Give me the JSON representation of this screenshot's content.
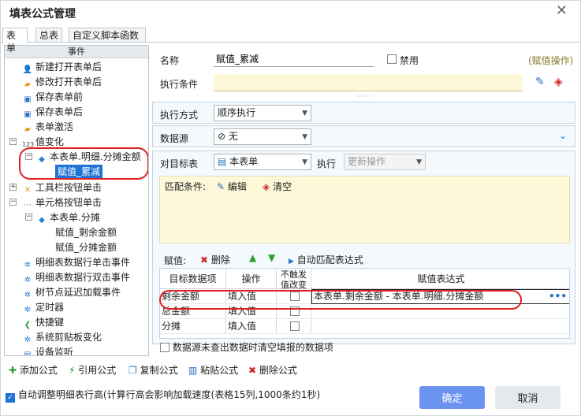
{
  "window": {
    "title": "填表公式管理"
  },
  "tabs": [
    "表单",
    "总表",
    "自定义脚本函数"
  ],
  "tree": {
    "header": "事件",
    "items": [
      "新建打开表单后",
      "修改打开表单后",
      "保存表单前",
      "保存表单后",
      "表单激活",
      "值变化",
      "本表单.明细.分摊金额",
      "赋值_累减",
      "工具栏按钮单击",
      "单元格按钮单击",
      "本表单.分摊",
      "赋值_剩余金额",
      "赋值_分摊金额",
      "明细表数据行单击事件",
      "明细表数据行双击事件",
      "树节点延迟加载事件",
      "定时器",
      "快捷键",
      "系统剪贴板变化",
      "设备监听"
    ]
  },
  "form": {
    "name_label": "名称",
    "name_value": "赋值_累减",
    "disable_label": "禁用",
    "op_tag": "(赋值操作)",
    "cond_label": "执行条件",
    "exec_mode_label": "执行方式",
    "exec_mode_value": "顺序执行",
    "source_label": "数据源",
    "source_value": "无",
    "target_label": "对目标表",
    "target_value": "本表单",
    "exec_label": "执行",
    "exec_value": "更新操作",
    "match_label": "匹配条件:",
    "edit_label": "编辑",
    "clear_label": "清空",
    "assign_label": "赋值:",
    "delete_label": "删除",
    "auto_match_label": "自动匹配表达式"
  },
  "grid": {
    "headers": [
      "目标数据项",
      "操作",
      "不触发\n值改变",
      "赋值表达式"
    ],
    "rows": [
      {
        "target": "剩余金额",
        "op": "填入值",
        "expr": "本表单.剩余金额 - 本表单.明细.分摊金额"
      },
      {
        "target": "总金额",
        "op": "填入值",
        "expr": ""
      },
      {
        "target": "分摊",
        "op": "填入值",
        "expr": ""
      }
    ],
    "more": "•••"
  },
  "clear_when_empty": "数据源未查出数据时清空填报的数据项",
  "actions": [
    "添加公式",
    "引用公式",
    "复制公式",
    "粘贴公式",
    "删除公式"
  ],
  "auto_adjust": "自动调整明细表行高(计算行高会影响加载速度(表格15列,1000条约1秒)",
  "buttons": {
    "ok": "确定",
    "cancel": "取消"
  }
}
